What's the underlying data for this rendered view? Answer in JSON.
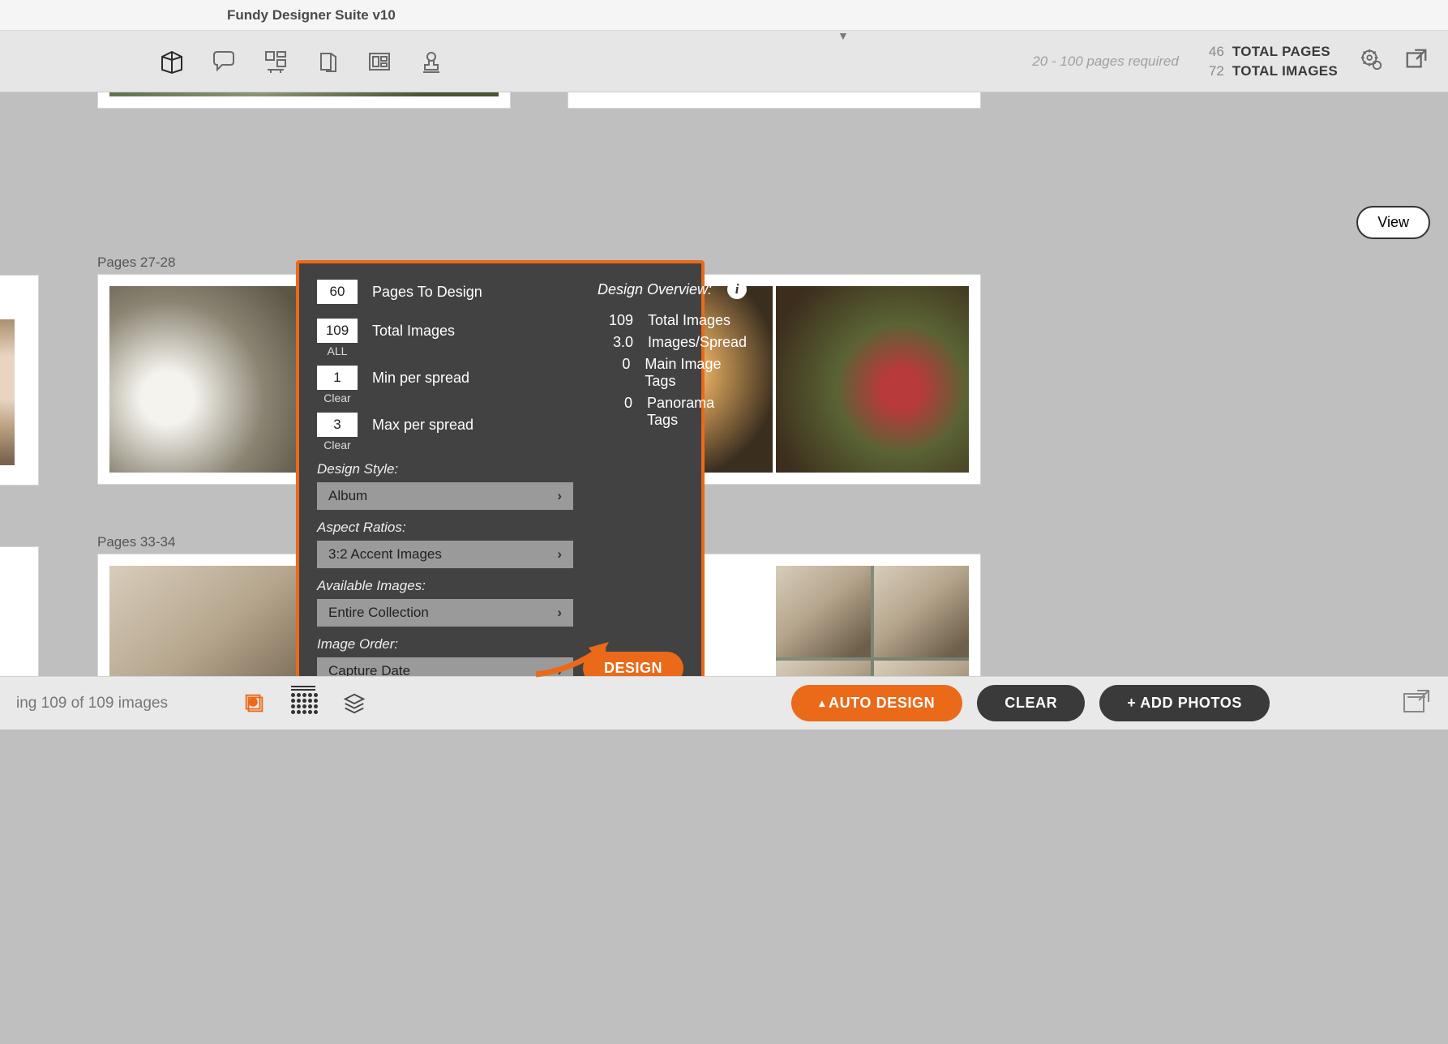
{
  "app_title": "Fundy Designer Suite v10",
  "toolbar": {
    "pages_required": "20 - 100 pages required",
    "total_pages_num": "46",
    "total_pages_label": "TOTAL PAGES",
    "total_images_num": "72",
    "total_images_label": "TOTAL IMAGES"
  },
  "view_button": "View",
  "spreads": {
    "row2_left_label": "Pages 27-28",
    "row3_left_label": "Pages 33-34"
  },
  "popup": {
    "pages_to_design_value": "60",
    "pages_to_design_label": "Pages To Design",
    "total_images_value": "109",
    "total_images_label": "Total Images",
    "total_images_sub": "ALL",
    "min_per_spread_value": "1",
    "min_per_spread_label": "Min per spread",
    "min_sub": "Clear",
    "max_per_spread_value": "3",
    "max_per_spread_label": "Max per spread",
    "max_sub": "Clear",
    "design_style_head": "Design Style:",
    "design_style_value": "Album",
    "aspect_ratios_head": "Aspect Ratios:",
    "aspect_ratios_value": "3:2 Accent Images",
    "available_images_head": "Available Images:",
    "available_images_value": "Entire Collection",
    "image_order_head": "Image Order:",
    "image_order_value": "Capture Date",
    "overview_head": "Design Overview:",
    "ov_total_images_num": "109",
    "ov_total_images_label": "Total Images",
    "ov_images_spread_num": "3.0",
    "ov_images_spread_label": "Images/Spread",
    "ov_main_tags_num": "0",
    "ov_main_tags_label": "Main Image Tags",
    "ov_panorama_num": "0",
    "ov_panorama_label": "Panorama Tags",
    "design_button": "DESIGN"
  },
  "footer": {
    "status_text": "ing 109 of 109 images",
    "auto_design": "AUTO DESIGN",
    "clear": "CLEAR",
    "add_photos": "+ ADD PHOTOS"
  }
}
